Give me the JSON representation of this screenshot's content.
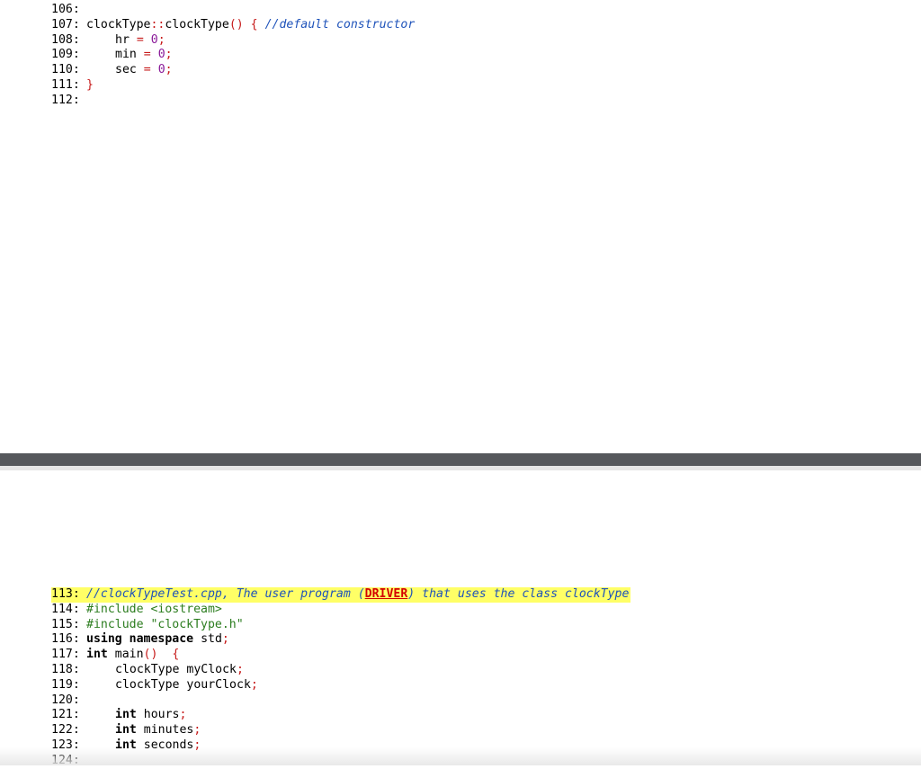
{
  "top_page": {
    "lines": [
      {
        "num": "106:"
      },
      {
        "num": "107:",
        "class_name": "clockType",
        "scope": "::",
        "method": "clockType",
        "parens": "()",
        "brace": "{",
        "comment": "//default constructor"
      },
      {
        "num": "108:",
        "var": "hr",
        "op": "=",
        "value": "0",
        "semi": ";"
      },
      {
        "num": "109:",
        "var": "min",
        "op": "=",
        "value": "0",
        "semi": ";"
      },
      {
        "num": "110:",
        "var": "sec",
        "op": "=",
        "value": "0",
        "semi": ";"
      },
      {
        "num": "111:",
        "brace": "}"
      },
      {
        "num": "112:"
      }
    ]
  },
  "bottom_page": {
    "lines": [
      {
        "num": "113:",
        "comment_a": "//clockTypeTest.cpp, The user program (",
        "driver": "DRIVER",
        "comment_b": ") that uses the class clockType"
      },
      {
        "num": "114:",
        "include": "#include <iostream>"
      },
      {
        "num": "115:",
        "include": "#include \"clockType.h\""
      },
      {
        "num": "116:",
        "kw1": "using",
        "kw2": "namespace",
        "ident": "std",
        "semi": ";"
      },
      {
        "num": "117:",
        "kw": "int",
        "ident": "main",
        "parens": "()",
        "brace": "{"
      },
      {
        "num": "118:",
        "type": "clockType",
        "ident": "myClock",
        "semi": ";"
      },
      {
        "num": "119:",
        "type": "clockType",
        "ident": "yourClock",
        "semi": ";"
      },
      {
        "num": "120:"
      },
      {
        "num": "121:",
        "kw": "int",
        "ident": "hours",
        "semi": ";"
      },
      {
        "num": "122:",
        "kw": "int",
        "ident": "minutes",
        "semi": ";"
      },
      {
        "num": "123:",
        "kw": "int",
        "ident": "seconds",
        "semi": ";"
      },
      {
        "num": "124:"
      }
    ]
  },
  "colors": {
    "punctuation": "#c61a1a",
    "number": "#8a1a99",
    "comment": "#1f53ba",
    "preprocessor": "#2c7d1f",
    "highlight": "#ffff66",
    "divider": "#56585c"
  }
}
